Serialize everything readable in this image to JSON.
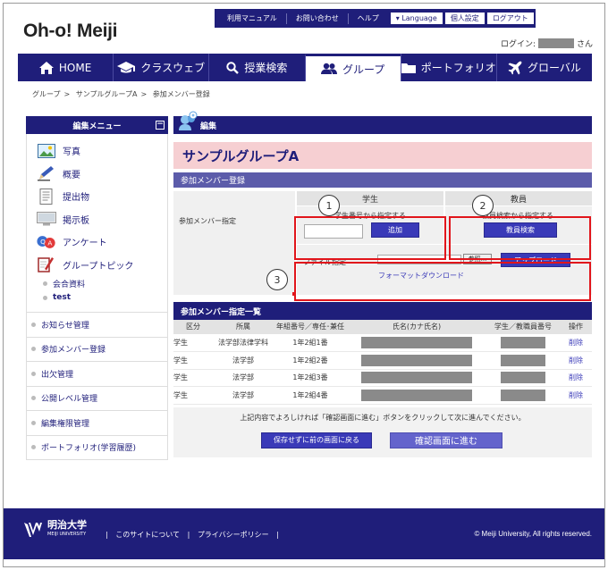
{
  "site": {
    "logo": "Oh-o! Meiji"
  },
  "util": {
    "items": [
      "利用マニュアル",
      "お問い合わせ",
      "ヘルプ"
    ],
    "language": "▾ Language",
    "personal": "個人設定",
    "logout": "ログアウト"
  },
  "login": {
    "label": "ログイン:",
    "suffix": "さん"
  },
  "gnav": {
    "items": [
      "HOME",
      "クラスウェブ",
      "授業検索",
      "グループ",
      "ポートフォリオ",
      "グローバル"
    ]
  },
  "breadcrumb": [
    "グループ",
    "サンプルグループA",
    "参加メンバー登録"
  ],
  "sidebar": {
    "title": "編集メニュー",
    "items": [
      "写真",
      "概要",
      "提出物",
      "掲示板",
      "アンケート",
      "グループトピック"
    ],
    "subitems": [
      "会合資料",
      "test"
    ],
    "menus": [
      "お知らせ管理",
      "参加メンバー登録",
      "出欠管理",
      "公開レベル管理",
      "編集権限管理",
      "ポートフォリオ(学習履歴)"
    ]
  },
  "main": {
    "edit_label": "編集",
    "group_title": "サンプルグループA",
    "reg_section": "参加メンバー登録",
    "col_student": "学生",
    "col_faculty": "教員",
    "row_label": "参加メンバー指定",
    "student_by_number": "学生番号から指定する",
    "add_button": "追加",
    "faculty_by_search": "教員検索から指定する",
    "faculty_search_button": "教員検索",
    "file_label": "ファイル指定",
    "browse_button": "参照...",
    "upload_button": "アップロード",
    "format_download": "フォーマットダウンロード",
    "callouts": [
      "1",
      "2",
      "3"
    ]
  },
  "list": {
    "title": "参加メンバー指定一覧",
    "headers": [
      "区分",
      "所属",
      "年組番号／専任･兼任",
      "氏名(カナ氏名)",
      "学生／教職員番号",
      "操作"
    ],
    "rows": [
      {
        "kubun": "学生",
        "shozoku": "法学部法律学科",
        "nen": "1年2組1番",
        "op": "削除"
      },
      {
        "kubun": "学生",
        "shozoku": "法学部",
        "nen": "1年2組2番",
        "op": "削除"
      },
      {
        "kubun": "学生",
        "shozoku": "法学部",
        "nen": "1年2組3番",
        "op": "削除"
      },
      {
        "kubun": "学生",
        "shozoku": "法学部",
        "nen": "1年2組4番",
        "op": "削除"
      }
    ]
  },
  "confirm": {
    "message": "上記内容でよろしければ「確認画面に進む」ボタンをクリックして次に進んでください。",
    "back_button": "保存せずに前の画面に戻る",
    "next_button": "確認画面に進む"
  },
  "footer": {
    "univ_name": "明治大学",
    "univ_en": "MEIJI UNIVERSITY",
    "links": [
      "このサイトについて",
      "プライバシーポリシー"
    ],
    "copyright": "© Meiji University, All rights reserved."
  }
}
